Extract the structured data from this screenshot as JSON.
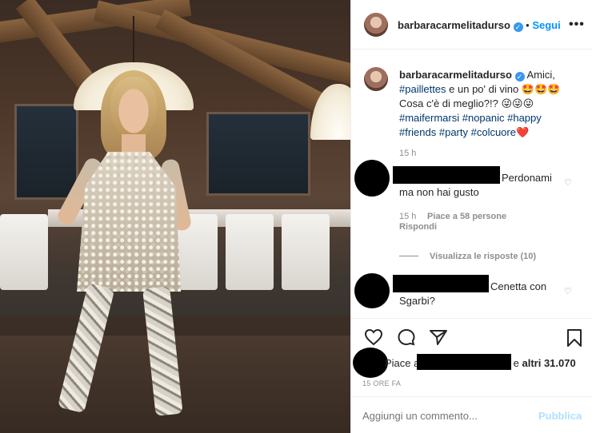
{
  "header": {
    "username": "barbaracarmelitadurso",
    "follow_label": "Segui",
    "more_label": "•••"
  },
  "caption": {
    "username": "barbaracarmelitadurso",
    "line1": "Amici,",
    "line2_tag": "#paillettes",
    "line2_text": " e un po' di vino 🤩🤩🤩",
    "line3": "Cosa c'è di meglio?!? 😜😜😜",
    "line4_tags": "#maifermarsi #nopanic #happy",
    "line5_tags": "#friends #party #colcuore",
    "line5_emoji": "❤️",
    "time": "15 h"
  },
  "comments": [
    {
      "text": "Perdonami ma non hai gusto",
      "time": "15 h",
      "likes": "Piace a 58 persone",
      "reply": "Rispondi"
    },
    {
      "view_replies": "Visualizza le risposte (10)"
    },
    {
      "text": "Cenetta con Sgarbi?"
    }
  ],
  "likes": {
    "prefix": "Piace a",
    "suffix": "e",
    "count": "altri 31.070"
  },
  "timestamp": "15 ORE FA",
  "add_comment": {
    "placeholder": "Aggiungi un commento...",
    "publish": "Pubblica"
  },
  "colors": {
    "accent": "#0095f6",
    "hashtag": "#00376b",
    "muted": "#8e8e8e",
    "heart_emoji": "#ed4956"
  }
}
